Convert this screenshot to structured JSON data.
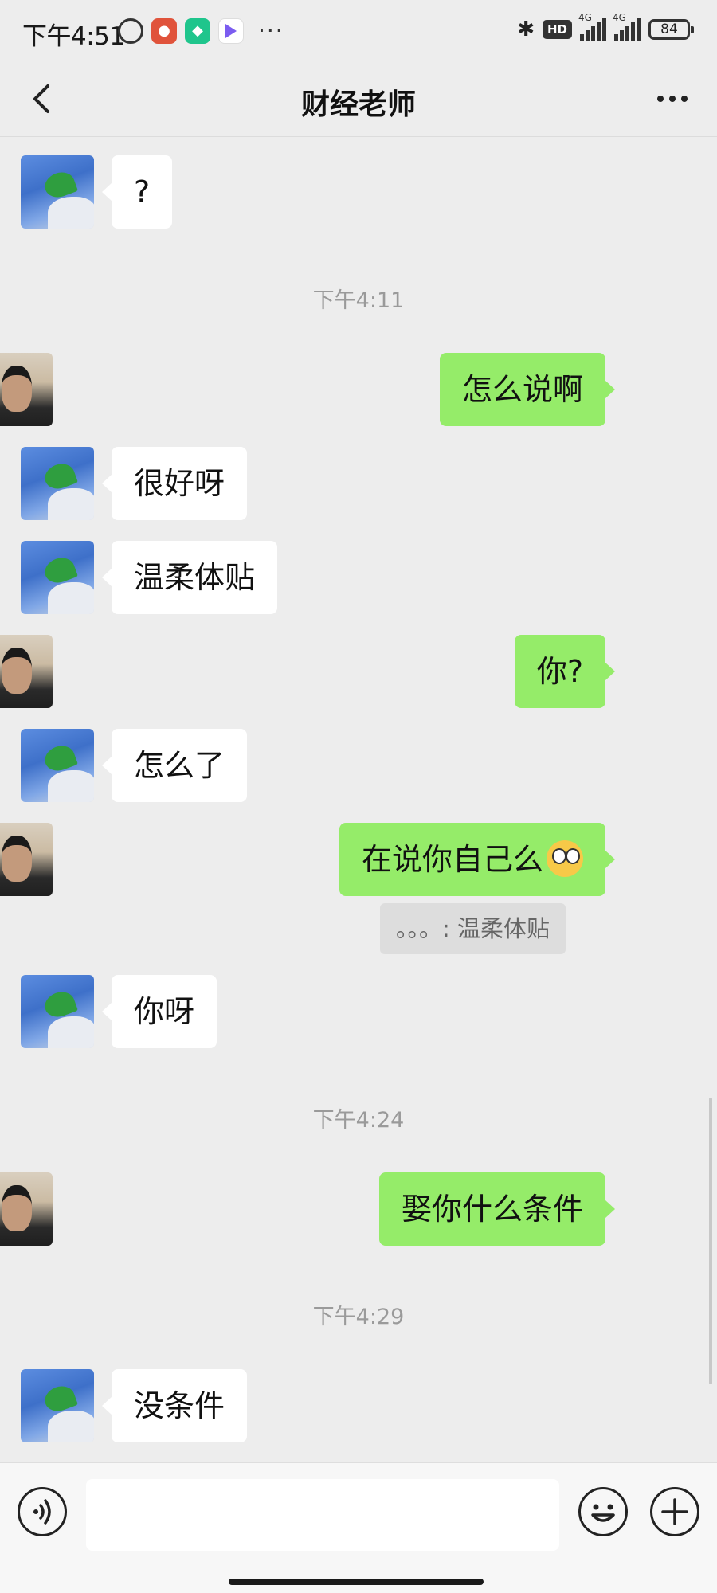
{
  "status_bar": {
    "time": "下午4:51",
    "signal_label_1": "4G",
    "signal_label_2": "4G",
    "hd_label": "HD",
    "battery": "84",
    "more": "···"
  },
  "nav": {
    "title": "财经老师"
  },
  "messages": [
    {
      "side": "left",
      "text": "?"
    },
    {
      "type": "time",
      "text": "下午4:11"
    },
    {
      "side": "right",
      "text": "怎么说啊"
    },
    {
      "side": "left",
      "text": "很好呀"
    },
    {
      "side": "left",
      "text": "温柔体贴"
    },
    {
      "side": "right",
      "text": "你?"
    },
    {
      "side": "left",
      "text": "怎么了"
    },
    {
      "side": "right",
      "text": "在说你自己么",
      "emoji": "flushed-face-emoji"
    },
    {
      "type": "quote",
      "text": "。。。: 温柔体贴"
    },
    {
      "side": "left",
      "text": "你呀"
    },
    {
      "type": "time",
      "text": "下午4:24"
    },
    {
      "side": "right",
      "text": "娶你什么条件"
    },
    {
      "type": "time",
      "text": "下午4:29"
    },
    {
      "side": "left",
      "text": "没条件"
    }
  ],
  "colors": {
    "background": "#ededed",
    "my_bubble": "#95ec69",
    "their_bubble": "#ffffff"
  }
}
